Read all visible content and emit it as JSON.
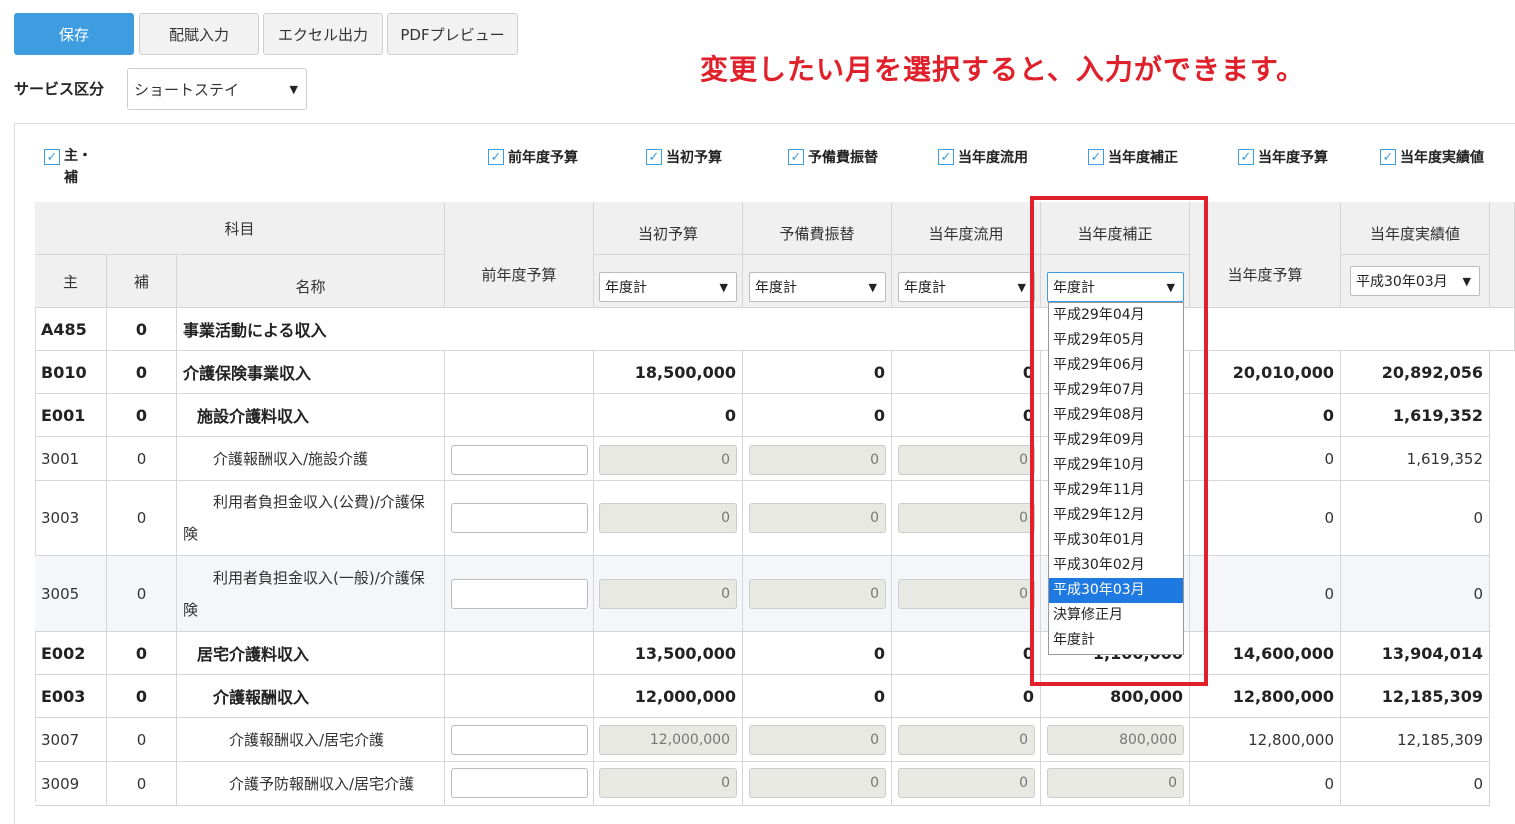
{
  "toolbar": {
    "save": "保存",
    "distribution_input": "配賦入力",
    "excel_output": "エクセル出力",
    "pdf_preview": "PDFプレビュー"
  },
  "service": {
    "label": "サービス区分",
    "value": "ショートステイ"
  },
  "notice": "変更したい月を選択すると、入力ができます。",
  "checkboxes": {
    "main_sub_1": "主・",
    "main_sub_2": "補",
    "prev_budget": "前年度予算",
    "initial_budget": "当初予算",
    "reserve_transfer": "予備費振替",
    "current_diversion": "当年度流用",
    "current_correction": "当年度補正",
    "current_budget": "当年度予算",
    "current_actual": "当年度実績値"
  },
  "table": {
    "headers": {
      "subject": "科目",
      "main": "主",
      "sub": "補",
      "name": "名称",
      "prev_budget": "前年度予算",
      "initial_budget": "当初予算",
      "reserve_transfer": "予備費振替",
      "current_diversion": "当年度流用",
      "current_correction": "当年度補正",
      "current_budget": "当年度予算",
      "current_actual": "当年度実績値"
    },
    "selects": {
      "initial_budget": "年度計",
      "reserve_transfer": "年度計",
      "current_diversion": "年度計",
      "current_correction": "年度計",
      "current_actual": "平成30年03月"
    },
    "rows": [
      {
        "code": "A485",
        "sub": "0",
        "name": "事業活動による収入",
        "bold": true
      },
      {
        "code": "B010",
        "sub": "0",
        "name": "介護保険事業収入",
        "bold": true,
        "initial": "18,500,000",
        "reserve": "0",
        "diversion": "0",
        "correction": "",
        "current": "20,010,000",
        "actual": "20,892,056"
      },
      {
        "code": "E001",
        "sub": "0",
        "name": "施設介護料収入",
        "bold": true,
        "initial": "0",
        "reserve": "0",
        "diversion": "0",
        "correction": "",
        "current": "0",
        "actual": "1,619,352"
      },
      {
        "code": "3001",
        "sub": "0",
        "name": "介護報酬収入/施設介護",
        "initial": "0",
        "reserve": "0",
        "diversion": "0",
        "current": "0",
        "actual": "1,619,352"
      },
      {
        "code": "3003",
        "sub": "0",
        "name_1": "利用者負担金収入(公費)/介護保",
        "name_2": "険",
        "initial": "0",
        "reserve": "0",
        "diversion": "0",
        "current": "0",
        "actual": "0"
      },
      {
        "code": "3005",
        "sub": "0",
        "name_1": "利用者負担金収入(一般)/介護保",
        "name_2": "険",
        "initial": "0",
        "reserve": "0",
        "diversion": "0",
        "current": "0",
        "actual": "0"
      },
      {
        "code": "E002",
        "sub": "0",
        "name": "居宅介護料収入",
        "bold": true,
        "initial": "13,500,000",
        "reserve": "0",
        "diversion": "0",
        "correction": "1,100,000",
        "current": "14,600,000",
        "actual": "13,904,014"
      },
      {
        "code": "E003",
        "sub": "0",
        "name": "介護報酬収入",
        "bold": true,
        "initial": "12,000,000",
        "reserve": "0",
        "diversion": "0",
        "correction": "800,000",
        "current": "12,800,000",
        "actual": "12,185,309"
      },
      {
        "code": "3007",
        "sub": "0",
        "name": "介護報酬収入/居宅介護",
        "initial": "12,000,000",
        "reserve": "0",
        "diversion": "0",
        "correction": "800,000",
        "current": "12,800,000",
        "actual": "12,185,309"
      },
      {
        "code": "3009",
        "sub": "0",
        "name": "介護予防報酬収入/居宅介護",
        "initial": "0",
        "reserve": "0",
        "diversion": "0",
        "correction": "0",
        "current": "0",
        "actual": "0"
      }
    ]
  },
  "dropdown_options": [
    "平成29年04月",
    "平成29年05月",
    "平成29年06月",
    "平成29年07月",
    "平成29年08月",
    "平成29年09月",
    "平成29年10月",
    "平成29年11月",
    "平成29年12月",
    "平成30年01月",
    "平成30年02月",
    "平成30年03月",
    "決算修正月",
    "年度計"
  ],
  "dropdown_selected": "平成30年03月",
  "colors": {
    "primary": "#3d9de0",
    "annotation": "#e0202a",
    "selected_option": "#1e79e0"
  }
}
